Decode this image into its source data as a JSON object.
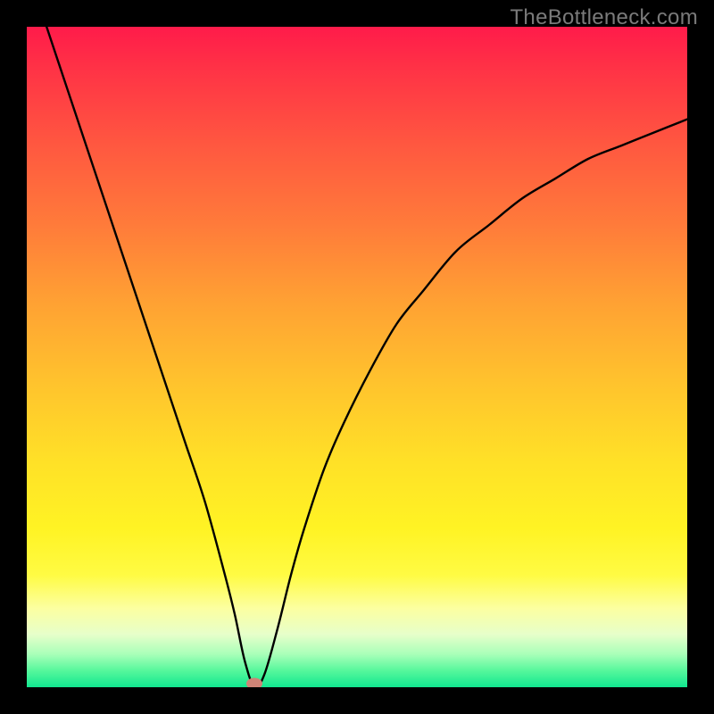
{
  "watermark": "TheBottleneck.com",
  "colors": {
    "frame_bg": "#000000",
    "watermark_text": "#7a7a7a",
    "curve_stroke": "#000000",
    "marker_fill": "#cf8477",
    "gradient_top": "#ff1b4a",
    "gradient_bottom": "#11e78f"
  },
  "chart_data": {
    "type": "line",
    "title": "",
    "xlabel": "",
    "ylabel": "",
    "xlim": [
      0,
      100
    ],
    "ylim": [
      0,
      100
    ],
    "legend": false,
    "grid": false,
    "series": [
      {
        "name": "bottleneck-curve",
        "x": [
          3,
          6,
          9,
          12,
          15,
          18,
          21,
          24,
          27,
          30,
          31.5,
          33,
          34.5,
          36,
          38,
          40,
          42,
          45,
          48,
          52,
          56,
          60,
          65,
          70,
          75,
          80,
          85,
          90,
          95,
          100
        ],
        "y": [
          100,
          91,
          82,
          73,
          64,
          55,
          46,
          37,
          28,
          17,
          11,
          4,
          0,
          2,
          9,
          17,
          24,
          33,
          40,
          48,
          55,
          60,
          66,
          70,
          74,
          77,
          80,
          82,
          84,
          86
        ]
      }
    ],
    "marker": {
      "x": 34.5,
      "y": 0.5
    },
    "background_gradient": {
      "direction": "vertical",
      "stops": [
        {
          "pos": 0.0,
          "color": "#ff1b4a"
        },
        {
          "pos": 0.18,
          "color": "#ff5840"
        },
        {
          "pos": 0.42,
          "color": "#ffa233"
        },
        {
          "pos": 0.66,
          "color": "#ffe127"
        },
        {
          "pos": 0.88,
          "color": "#fcffa0"
        },
        {
          "pos": 1.0,
          "color": "#11e78f"
        }
      ]
    }
  }
}
